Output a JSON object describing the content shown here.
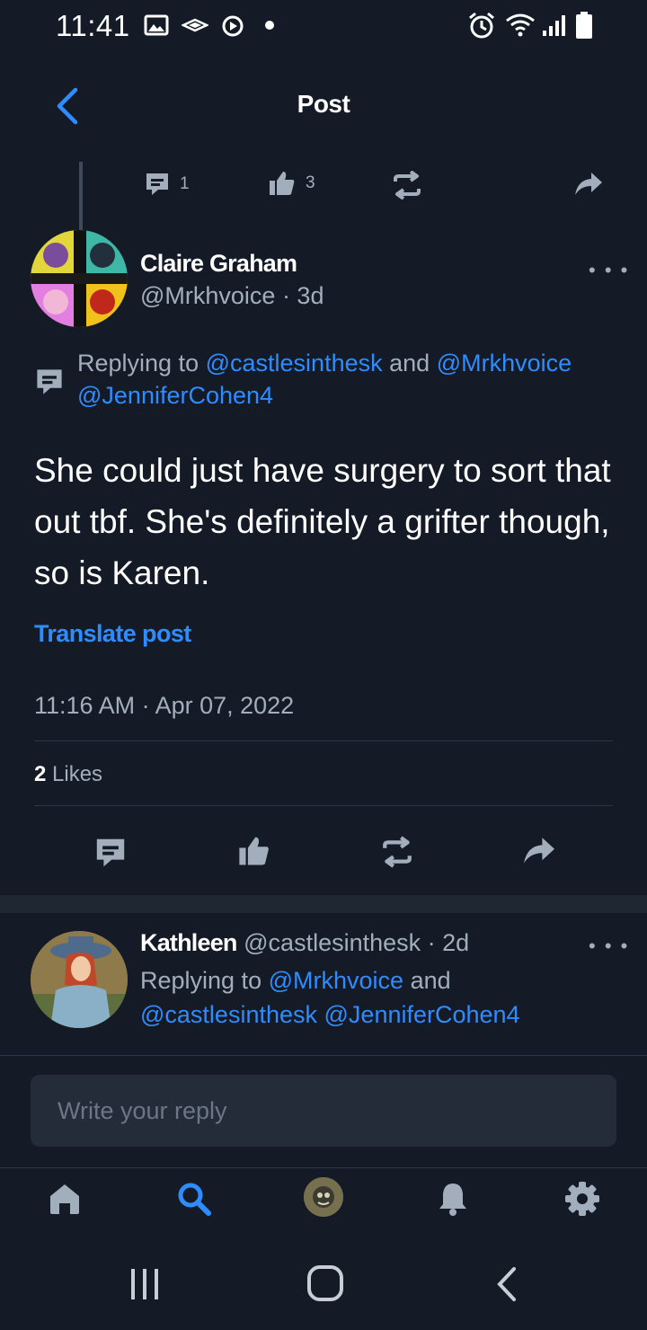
{
  "status_bar": {
    "time": "11:41"
  },
  "header": {
    "title": "Post"
  },
  "parent_actions": {
    "comments": "1",
    "likes": "3"
  },
  "post": {
    "author_name": "Claire Graham",
    "handle_time": "@Mrkhvoice · 3d",
    "replying_prefix": "Replying to",
    "mention_1": "@castlesinthesk",
    "and_word": "and",
    "mention_2": "@Mrkhvoice",
    "mention_3": "@JenniferCohen4",
    "text": "She could just have surgery to sort that out tbf. She's definitely a grifter though, so is Karen.",
    "translate_label": "Translate post",
    "timestamp": "11:16 AM · Apr 07, 2022",
    "likes_count": "2",
    "likes_label": "Likes"
  },
  "reply": {
    "author_name": "Kathleen",
    "handle_time": "@castlesinthesk · 2d",
    "replying_prefix": "Replying to",
    "mention_1": "@Mrkhvoice",
    "and_word": "and",
    "mention_2": "@castlesinthesk",
    "mention_3": "@JenniferCohen4"
  },
  "composer": {
    "placeholder": "Write your reply"
  },
  "icons": {
    "back": "chevron-left-icon",
    "comment": "comment-icon",
    "like": "thumbs-up-icon",
    "repost": "repost-icon",
    "share": "share-icon",
    "more": "more-icon",
    "home": "home-icon",
    "search": "search-icon",
    "notifications": "bell-icon",
    "settings": "gear-icon"
  },
  "colors": {
    "background": "#141b26",
    "accent": "#2f8cff",
    "muted": "#a3aebd"
  }
}
